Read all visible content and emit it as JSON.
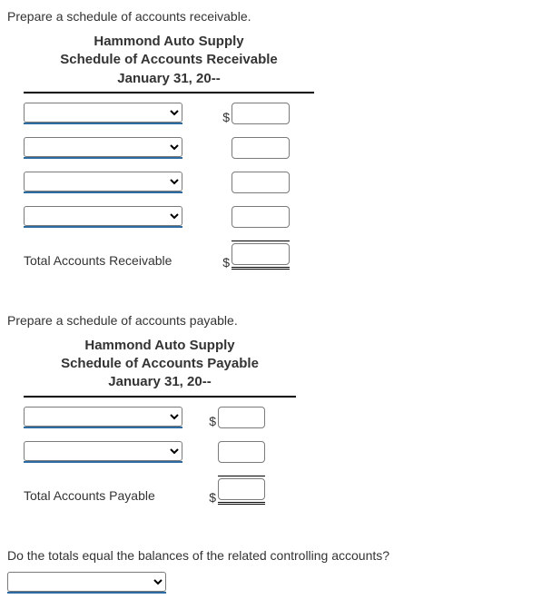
{
  "receivable": {
    "question": "Prepare a schedule of accounts receivable.",
    "header_company": "Hammond Auto Supply",
    "header_title": "Schedule of Accounts Receivable",
    "header_date": "January 31, 20--",
    "dollar": "$",
    "total_label": "Total Accounts Receivable",
    "rows": [
      {
        "account": "",
        "show_dollar": true,
        "amount": ""
      },
      {
        "account": "",
        "show_dollar": false,
        "amount": ""
      },
      {
        "account": "",
        "show_dollar": false,
        "amount": ""
      },
      {
        "account": "",
        "show_dollar": false,
        "amount": ""
      }
    ],
    "total_amount": ""
  },
  "payable": {
    "question": "Prepare a schedule of accounts payable.",
    "header_company": "Hammond Auto Supply",
    "header_title": "Schedule of Accounts Payable",
    "header_date": "January 31, 20--",
    "dollar": "$",
    "total_label": "Total Accounts Payable",
    "rows": [
      {
        "account": "",
        "show_dollar": true,
        "amount": ""
      },
      {
        "account": "",
        "show_dollar": false,
        "amount": ""
      }
    ],
    "total_amount": ""
  },
  "final": {
    "question": "Do the totals equal the balances of the related controlling accounts?",
    "value": ""
  }
}
